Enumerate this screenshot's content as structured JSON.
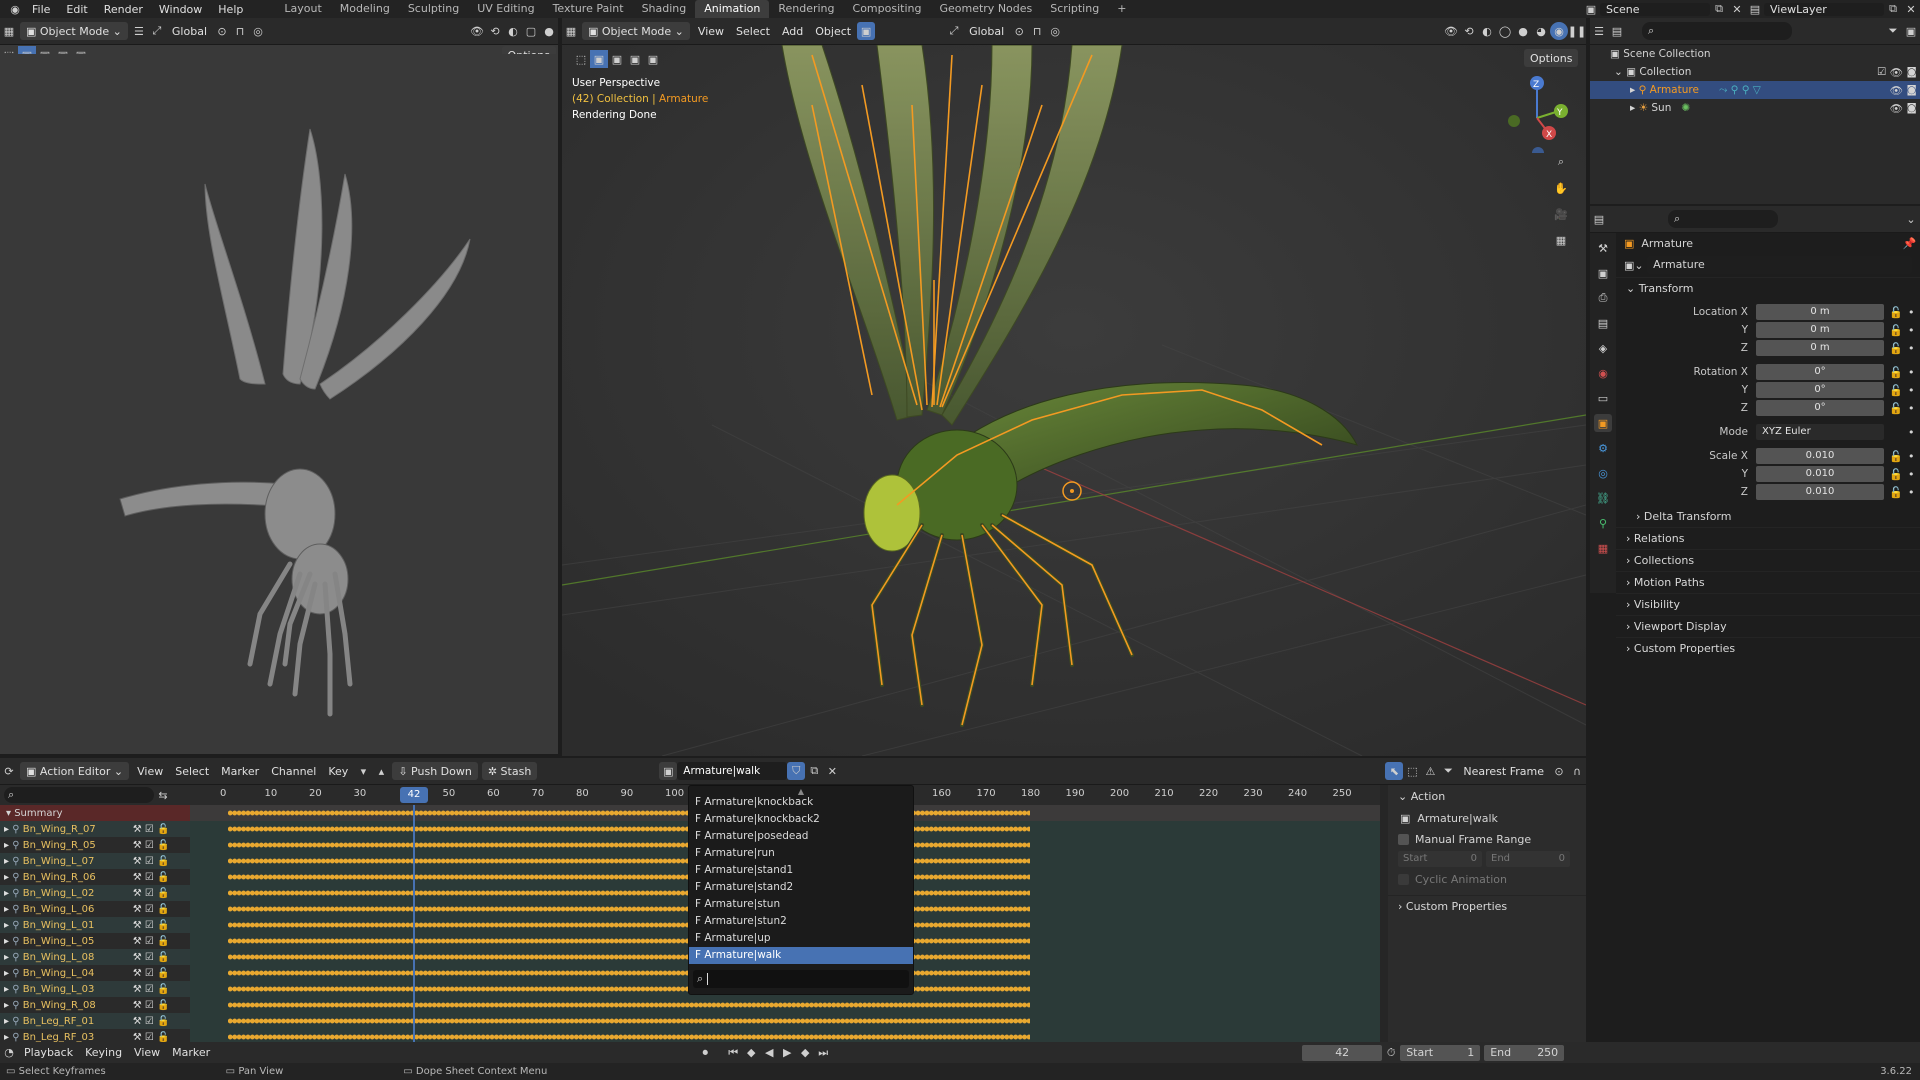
{
  "menubar": {
    "menus": [
      "File",
      "Edit",
      "Render",
      "Window",
      "Help"
    ],
    "workspaces": [
      "Layout",
      "Modeling",
      "Sculpting",
      "UV Editing",
      "Texture Paint",
      "Shading",
      "Animation",
      "Rendering",
      "Compositing",
      "Geometry Nodes",
      "Scripting"
    ],
    "active_workspace": "Animation",
    "scene": "Scene",
    "view_layer": "ViewLayer"
  },
  "left_viewport": {
    "mode": "Object Mode",
    "orientation": "Global",
    "options": "Options"
  },
  "main_viewport": {
    "mode": "Object Mode",
    "menus": [
      "View",
      "Select",
      "Add",
      "Object"
    ],
    "orientation": "Global",
    "options": "Options",
    "overlay_line1": "User Perspective",
    "overlay_line2_prefix": "(42) Collection | ",
    "overlay_line2_obj": "Armature",
    "overlay_line3": "Rendering Done"
  },
  "outliner": {
    "root": "Scene Collection",
    "collection": "Collection",
    "items": [
      "Armature",
      "Sun"
    ]
  },
  "properties": {
    "object_name": "Armature",
    "data_name": "Armature",
    "transform_label": "Transform",
    "location_label": "Location X",
    "location": [
      "0 m",
      "0 m",
      "0 m"
    ],
    "rotation_label": "Rotation X",
    "rotation": [
      "0°",
      "0°",
      "0°"
    ],
    "mode_label": "Mode",
    "mode_value": "XYZ Euler",
    "scale_label": "Scale X",
    "scale": [
      "0.010",
      "0.010",
      "0.010"
    ],
    "axis_y": "Y",
    "axis_z": "Z",
    "delta": "Delta Transform",
    "panels": [
      "Relations",
      "Collections",
      "Motion Paths",
      "Visibility",
      "Viewport Display",
      "Custom Properties"
    ]
  },
  "dopesheet": {
    "editor": "Action Editor",
    "menus": [
      "View",
      "Select",
      "Marker",
      "Channel",
      "Key"
    ],
    "push_down": "Push Down",
    "stash": "Stash",
    "action": "Armature|walk",
    "snap": "Nearest Frame",
    "frame_ticks": [
      "0",
      "10",
      "20",
      "30",
      "42",
      "50",
      "60",
      "70",
      "80",
      "90",
      "100",
      "160",
      "170",
      "180",
      "190",
      "200",
      "210",
      "220",
      "230",
      "240",
      "250"
    ],
    "current_frame": "42",
    "summary": "Summary",
    "channels": [
      "Bn_Wing_R_07",
      "Bn_Wing_R_05",
      "Bn_Wing_L_07",
      "Bn_Wing_R_06",
      "Bn_Wing_L_02",
      "Bn_Wing_L_06",
      "Bn_Wing_L_01",
      "Bn_Wing_L_05",
      "Bn_Wing_L_08",
      "Bn_Wing_L_04",
      "Bn_Wing_L_03",
      "Bn_Wing_R_08",
      "Bn_Leg_RF_01",
      "Bn_Leg_RF_03"
    ],
    "action_dropdown": [
      "F Armature|knockback",
      "F Armature|knockback2",
      "F Armature|posedead",
      "F Armature|run",
      "F Armature|stand1",
      "F Armature|stand2",
      "F Armature|stun",
      "F Armature|stun2",
      "F Armature|up",
      "F Armature|walk"
    ],
    "side_panel": {
      "action_hdr": "Action",
      "action_name": "Armature|walk",
      "manual_range": "Manual Frame Range",
      "start_label": "Start",
      "start_val": "0",
      "end_label": "End",
      "end_val": "0",
      "cyclic": "Cyclic Animation",
      "custom": "Custom Properties"
    }
  },
  "timeline": {
    "menus": [
      "Playback",
      "Keying",
      "View",
      "Marker"
    ],
    "frame": "42",
    "start_label": "Start",
    "start": "1",
    "end_label": "End",
    "end": "250"
  },
  "status": {
    "left": "Select Keyframes",
    "mid": "Pan View",
    "right": "Dope Sheet Context Menu",
    "version": "3.6.22"
  }
}
